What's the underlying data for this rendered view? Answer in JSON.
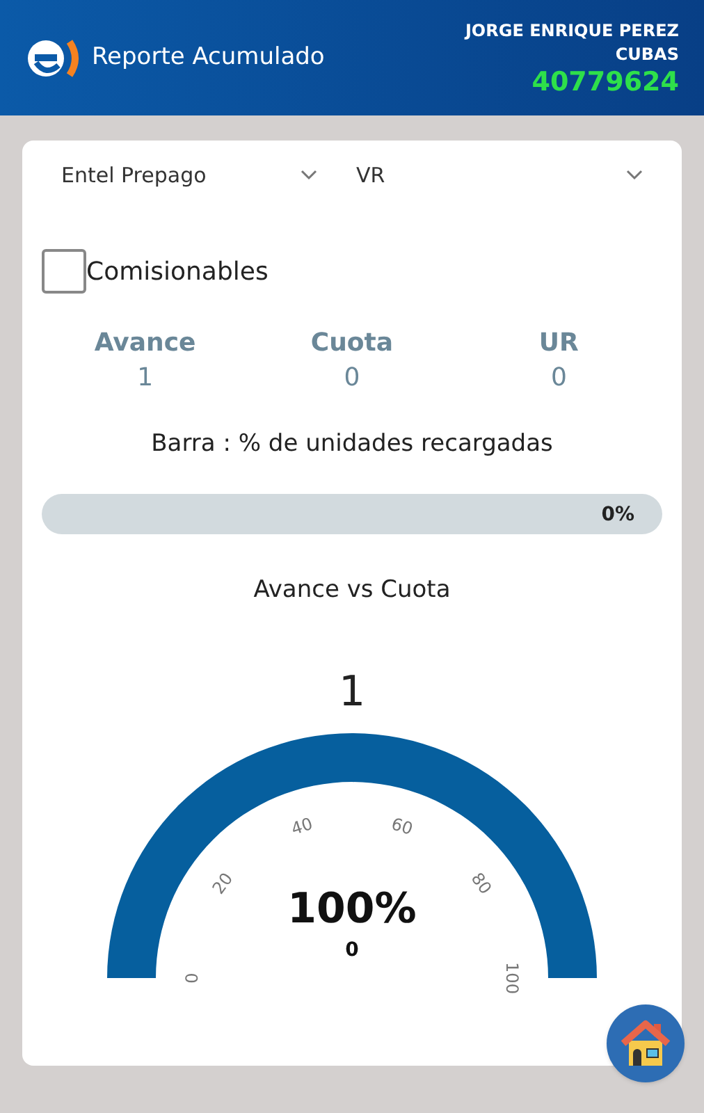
{
  "header": {
    "title": "Reporte Acumulado",
    "user_name": "JORGE ENRIQUE PEREZ CUBAS",
    "user_code": "40779624"
  },
  "filters": [
    {
      "value": "Entel Prepago"
    },
    {
      "value": "VR"
    }
  ],
  "comisionables": {
    "label": "Comisionables",
    "checked": false
  },
  "stats": [
    {
      "label": "Avance",
      "value": "1"
    },
    {
      "label": "Cuota",
      "value": "0"
    },
    {
      "label": "UR",
      "value": "0"
    }
  ],
  "bar": {
    "caption": "Barra : % de unidades recargadas",
    "level": 0,
    "reading": "0%"
  },
  "gauge": {
    "title": "Avance vs Cuota",
    "value": "1",
    "percent": "100%",
    "subvalue": "0",
    "ticks": [
      "0",
      "20",
      "40",
      "60",
      "80",
      "100"
    ]
  }
}
